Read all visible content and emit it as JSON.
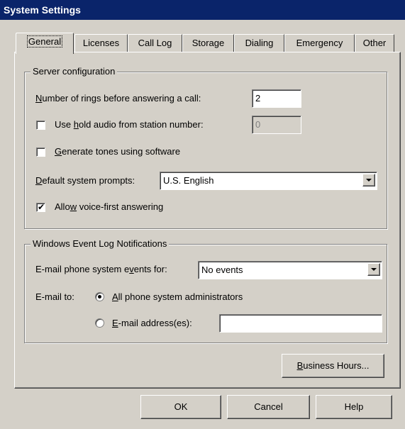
{
  "window": {
    "title": "System Settings"
  },
  "tabs": [
    {
      "label": "General",
      "active": true
    },
    {
      "label": "Licenses"
    },
    {
      "label": "Call Log"
    },
    {
      "label": "Storage"
    },
    {
      "label": "Dialing"
    },
    {
      "label": "Emergency"
    },
    {
      "label": "Other"
    }
  ],
  "server_config": {
    "title": "Server configuration",
    "rings_label_pre": "",
    "rings_label_u": "N",
    "rings_label_post": "umber of rings before answering a call:",
    "rings_value": "2",
    "hold_audio": {
      "checked": false,
      "label_pre": "Use ",
      "label_u": "h",
      "label_post": "old audio from station number:",
      "value": "0"
    },
    "gen_tones": {
      "checked": false,
      "label_pre": "",
      "label_u": "G",
      "label_post": "enerate tones using software"
    },
    "prompts_label_pre": "",
    "prompts_label_u": "D",
    "prompts_label_post": "efault system prompts:",
    "prompts_value": "U.S. English",
    "voice_first": {
      "checked": true,
      "check_mark": "✔",
      "label_pre": "Allo",
      "label_u": "w",
      "label_post": " voice-first answering"
    }
  },
  "event_log": {
    "title": "Windows Event Log Notifications",
    "events_label_pre": "E-mail phone system e",
    "events_label_u": "v",
    "events_label_post": "ents for:",
    "events_value": "No events",
    "email_to_label": "E-mail to:",
    "radio_admins": {
      "selected": true,
      "label_pre": "",
      "label_u": "A",
      "label_post": "ll phone system administrators"
    },
    "radio_address": {
      "selected": false,
      "label_pre": "",
      "label_u": "E",
      "label_post": "-mail address(es):",
      "value": ""
    }
  },
  "business_hours": {
    "label_pre": "",
    "label_u": "B",
    "label_post": "usiness Hours..."
  },
  "footer": {
    "ok": "OK",
    "cancel": "Cancel",
    "help": "Help"
  },
  "colors": {
    "titlebar_bg": "#0a246a",
    "titlebar_fg": "#ffffff",
    "face": "#d4d0c8"
  }
}
